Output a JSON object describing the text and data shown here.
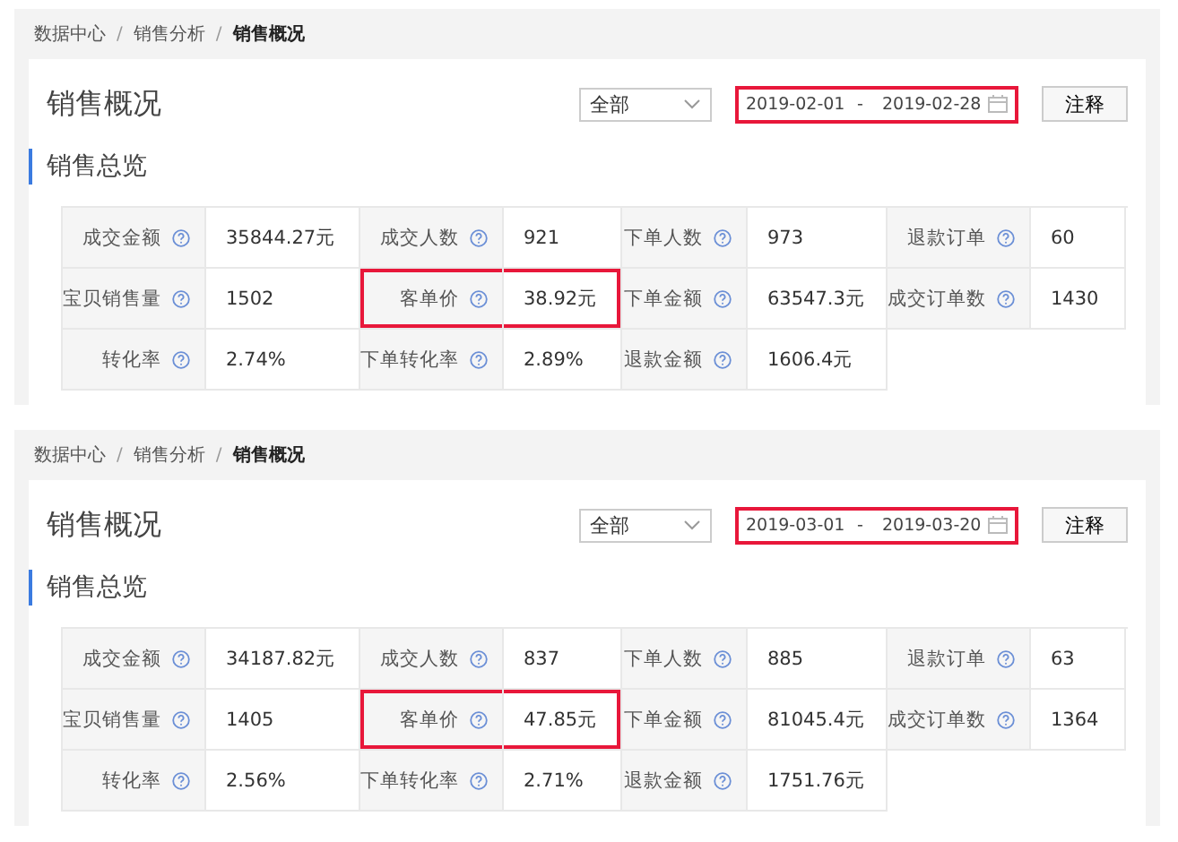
{
  "panels": [
    {
      "breadcrumb_separator": "/",
      "breadcrumb": [
        {
          "label": "数据中心",
          "current": false
        },
        {
          "label": "销售分析",
          "current": false
        },
        {
          "label": "销售概况",
          "current": true
        }
      ],
      "title": "销售概况",
      "select": {
        "value": "全部"
      },
      "date_range": {
        "start": "2019-02-01",
        "separator": "-",
        "end": "2019-02-28",
        "highlighted": true
      },
      "note_button": "注释",
      "section_title": "销售总览",
      "metrics": [
        {
          "label": "成交金额",
          "value": "35844.27元",
          "highlighted": false
        },
        {
          "label": "成交人数",
          "value": "921",
          "highlighted": false
        },
        {
          "label": "下单人数",
          "value": "973",
          "highlighted": false
        },
        {
          "label": "退款订单",
          "value": "60",
          "highlighted": false
        },
        {
          "label": "宝贝销售量",
          "value": "1502",
          "highlighted": false
        },
        {
          "label": "客单价",
          "value": "38.92元",
          "highlighted": true
        },
        {
          "label": "下单金额",
          "value": "63547.3元",
          "highlighted": false
        },
        {
          "label": "成交订单数",
          "value": "1430",
          "highlighted": false
        },
        {
          "label": "转化率",
          "value": "2.74%",
          "highlighted": false
        },
        {
          "label": "下单转化率",
          "value": "2.89%",
          "highlighted": false
        },
        {
          "label": "退款金额",
          "value": "1606.4元",
          "highlighted": false
        }
      ]
    },
    {
      "breadcrumb_separator": "/",
      "breadcrumb": [
        {
          "label": "数据中心",
          "current": false
        },
        {
          "label": "销售分析",
          "current": false
        },
        {
          "label": "销售概况",
          "current": true
        }
      ],
      "title": "销售概况",
      "select": {
        "value": "全部"
      },
      "date_range": {
        "start": "2019-03-01",
        "separator": "-",
        "end": "2019-03-20",
        "highlighted": true
      },
      "note_button": "注释",
      "section_title": "销售总览",
      "metrics": [
        {
          "label": "成交金额",
          "value": "34187.82元",
          "highlighted": false
        },
        {
          "label": "成交人数",
          "value": "837",
          "highlighted": false
        },
        {
          "label": "下单人数",
          "value": "885",
          "highlighted": false
        },
        {
          "label": "退款订单",
          "value": "63",
          "highlighted": false
        },
        {
          "label": "宝贝销售量",
          "value": "1405",
          "highlighted": false
        },
        {
          "label": "客单价",
          "value": "47.85元",
          "highlighted": true
        },
        {
          "label": "下单金额",
          "value": "81045.4元",
          "highlighted": false
        },
        {
          "label": "成交订单数",
          "value": "1364",
          "highlighted": false
        },
        {
          "label": "转化率",
          "value": "2.56%",
          "highlighted": false
        },
        {
          "label": "下单转化率",
          "value": "2.71%",
          "highlighted": false
        },
        {
          "label": "退款金额",
          "value": "1751.76元",
          "highlighted": false
        }
      ]
    }
  ]
}
